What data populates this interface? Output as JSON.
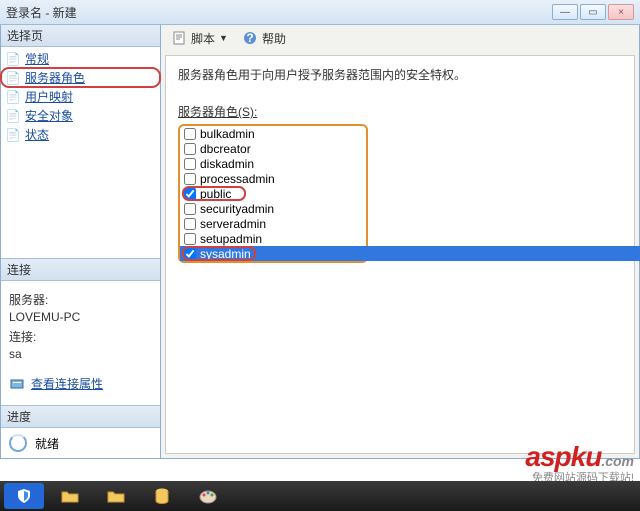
{
  "window": {
    "title": "登录名 - 新建",
    "min": "—",
    "max": "▭",
    "close": "×"
  },
  "leftpane": {
    "select_header": "选择页",
    "nav": {
      "general": "常规",
      "server_roles": "服务器角色",
      "user_mapping": "用户映射",
      "securables": "安全对象",
      "status": "状态"
    },
    "conn_header": "连接",
    "server_label": "服务器:",
    "server_value": "LOVEMU-PC",
    "conn_label": "连接:",
    "conn_value": "sa",
    "view_conn": "查看连接属性",
    "progress_header": "进度",
    "ready": "就绪"
  },
  "toolbar": {
    "script": "脚本",
    "help": "帮助"
  },
  "content": {
    "description": "服务器角色用于向用户授予服务器范围内的安全特权。",
    "roles_label": "服务器角色(S):",
    "roles": [
      {
        "name": "bulkadmin",
        "checked": false
      },
      {
        "name": "dbcreator",
        "checked": false
      },
      {
        "name": "diskadmin",
        "checked": false
      },
      {
        "name": "processadmin",
        "checked": false
      },
      {
        "name": "public",
        "checked": true
      },
      {
        "name": "securityadmin",
        "checked": false
      },
      {
        "name": "serveradmin",
        "checked": false
      },
      {
        "name": "setupadmin",
        "checked": false
      },
      {
        "name": "sysadmin",
        "checked": true
      }
    ]
  },
  "watermark": {
    "brand": "aspku",
    "dotcom": ".com",
    "sub": "免费网站源码下载站!"
  }
}
